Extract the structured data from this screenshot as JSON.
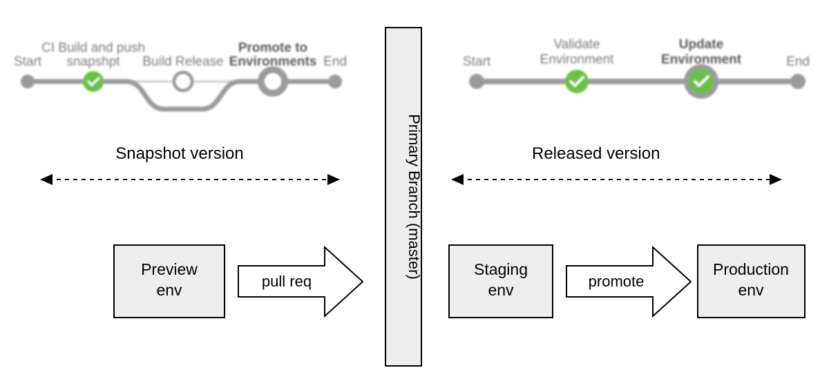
{
  "leftPipeline": {
    "stages": [
      {
        "label": "Start"
      },
      {
        "label": "CI Build and push snapshpt"
      },
      {
        "label": "Build Release"
      },
      {
        "label": "Promote to Environments"
      },
      {
        "label": "End"
      }
    ]
  },
  "rightPipeline": {
    "stages": [
      {
        "label": "Start"
      },
      {
        "label": "Validate Environment"
      },
      {
        "label": "Update Environment"
      },
      {
        "label": "End"
      }
    ]
  },
  "leftSection": {
    "title": "Snapshot version",
    "box": {
      "line1": "Preview",
      "line2": "env"
    },
    "arrowLabel": "pull req"
  },
  "rightSection": {
    "title": "Released version",
    "box1": {
      "line1": "Staging",
      "line2": "env"
    },
    "arrowLabel": "promote",
    "box2": {
      "line1": "Production",
      "line2": "env"
    }
  },
  "primaryBranch": "Primary Branch (master)",
  "colors": {
    "green": "#6cbf47",
    "gray": "#9b9b9b",
    "lightGray": "#d0d0d0",
    "boxFill": "#eeeeee",
    "boxStroke": "#000000"
  }
}
